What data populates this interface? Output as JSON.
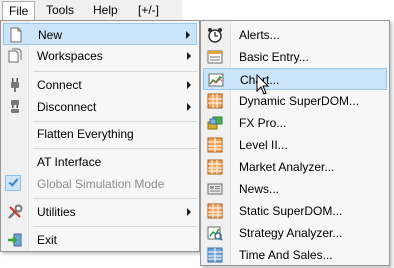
{
  "menubar": {
    "items": [
      {
        "label": "File",
        "active": true
      },
      {
        "label": "Tools",
        "active": false
      },
      {
        "label": "Help",
        "active": false
      },
      {
        "label": "[+/-]",
        "active": false
      }
    ]
  },
  "file_menu": {
    "items": [
      {
        "label": "New",
        "icon": "new-icon",
        "submenu": true,
        "highlight": true
      },
      {
        "label": "Workspaces",
        "icon": "workspaces-icon",
        "submenu": true
      },
      {
        "label": "Connect",
        "icon": "connect-plug-icon",
        "submenu": true
      },
      {
        "label": "Disconnect",
        "icon": "disconnect-plug-icon",
        "submenu": true
      },
      {
        "label": "Flatten Everything"
      },
      {
        "label": "AT Interface"
      },
      {
        "label": "Global Simulation Mode",
        "checked": true,
        "disabled": true
      },
      {
        "label": "Utilities",
        "icon": "utilities-icon",
        "submenu": true
      },
      {
        "label": "Exit",
        "icon": "exit-icon"
      }
    ]
  },
  "new_submenu": {
    "items": [
      {
        "label": "Alerts...",
        "icon": "alarm-clock-icon"
      },
      {
        "label": "Basic Entry...",
        "icon": "basic-entry-icon"
      },
      {
        "label": "Chart...",
        "icon": "chart-icon",
        "highlight": true
      },
      {
        "label": "Dynamic SuperDOM...",
        "icon": "dynamic-superdom-icon"
      },
      {
        "label": "FX Pro...",
        "icon": "fx-pro-icon"
      },
      {
        "label": "Level II...",
        "icon": "level-ii-icon"
      },
      {
        "label": "Market Analyzer...",
        "icon": "market-analyzer-icon"
      },
      {
        "label": "News...",
        "icon": "news-icon"
      },
      {
        "label": "Static SuperDOM...",
        "icon": "static-superdom-icon"
      },
      {
        "label": "Strategy Analyzer...",
        "icon": "strategy-analyzer-icon"
      },
      {
        "label": "Time And Sales...",
        "icon": "time-and-sales-icon"
      }
    ]
  },
  "colors": {
    "highlight_bg": "#cce4f7",
    "highlight_border": "#99c9ef",
    "menu_bg": "#f7f7f7",
    "disabled_text": "#8d8d8d"
  }
}
